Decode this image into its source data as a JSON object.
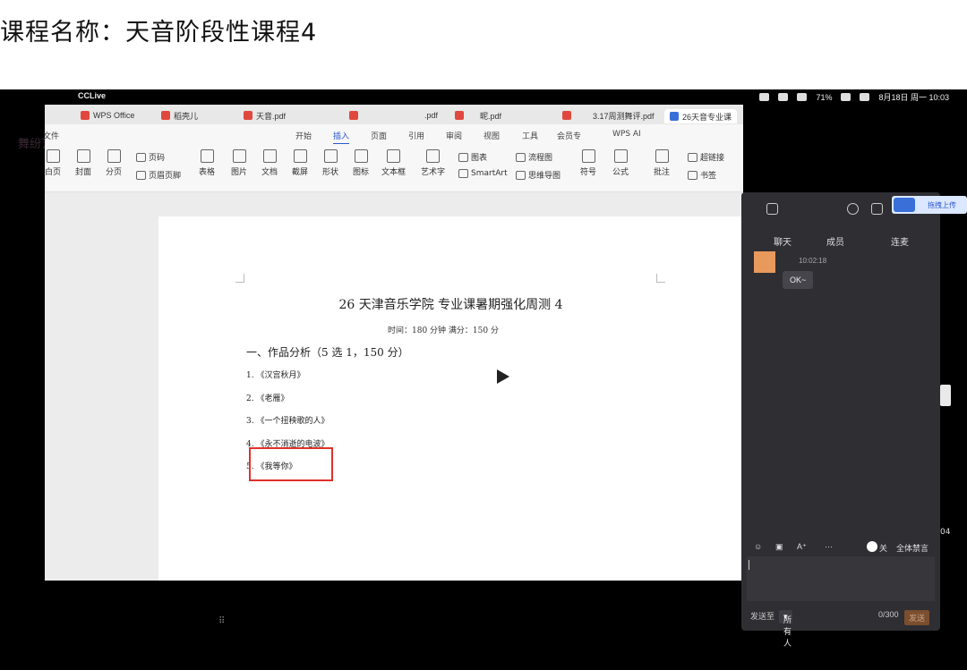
{
  "course": {
    "title": "课程名称：天音阶段性课程4"
  },
  "watermark": {
    "text": "舞纷艺剧"
  },
  "macbar": {
    "app_name": "CCLive",
    "battery": "71%",
    "datetime": "8月18日 周一  10:03"
  },
  "wps": {
    "tabs": [
      {
        "label": "WPS Office"
      },
      {
        "label": "稻壳儿"
      },
      {
        "label": "天音.pdf"
      },
      {
        "label": ".pdf"
      },
      {
        "label": "昵.pdf"
      },
      {
        "label": "3.17周测舞评.pdf"
      },
      {
        "label": "26天音专业课"
      }
    ],
    "menu": {
      "file": "文件",
      "start": "开始",
      "insert": "插入",
      "page": "页面",
      "reference": "引用",
      "review": "审阅",
      "view": "视图",
      "tools": "工具",
      "member": "会员专",
      "ai": "WPS AI"
    },
    "ribbon": {
      "blank_page": "白页",
      "cover": "封面",
      "section": "分页",
      "page_number": "页码",
      "header_footer": "页眉页脚",
      "table": "表格",
      "image": "图片",
      "document": "文档",
      "screenshot": "截屏",
      "shape": "形状",
      "icon": "图标",
      "textbox": "文本框",
      "art_text": "艺术字",
      "chart": "图表",
      "smartart": "SmartArt",
      "flowchart": "流程图",
      "mindmap": "思维导图",
      "symbol": "符号",
      "formula": "公式",
      "comment": "批注",
      "hyperlink": "超链接",
      "bookmark": "书签"
    }
  },
  "document": {
    "title": "26 天津音乐学院  专业课暑期强化周测 4",
    "subtitle": "时间：180 分钟    满分：150 分",
    "section": "一、作品分析（5 选 1，150 分）",
    "items": [
      "1.   《汉宫秋月》",
      "2.   《老雁》",
      "3.   《一个扭秧歌的人》",
      "4.   《永不消逝的电波》",
      "5.   《我等你》"
    ]
  },
  "chat": {
    "tabs": {
      "chat": "聊天",
      "members": "成员",
      "connect": "连麦"
    },
    "message": {
      "time": "10:02:18",
      "text": "OK~"
    },
    "toolbar": {
      "toggle_label": "关",
      "mute_all": "全体禁言"
    },
    "footer": {
      "send_to_label": "发送至",
      "send_to_value": "所有人",
      "counter": "0/300",
      "send_button": "发送"
    }
  },
  "upload": {
    "label": "拖拽上传"
  },
  "side_text": "04"
}
